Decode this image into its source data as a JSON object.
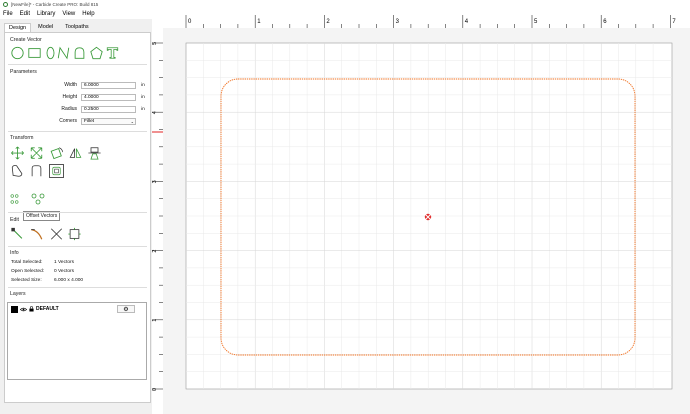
{
  "window": {
    "title": "[NewFile]* - Carbide Create PRO: Build 815"
  },
  "menu": {
    "items": [
      "File",
      "Edit",
      "Library",
      "View",
      "Help"
    ]
  },
  "tabs": [
    "Design",
    "Model",
    "Toolpaths"
  ],
  "panel": {
    "create_vector_title": "Create Vector",
    "parameters_title": "Parameters",
    "transform_title": "Transform",
    "edit_title": "Edit",
    "info_title": "Info",
    "layers_title": "Layers",
    "tooltip": "Offset Vectors"
  },
  "parameters": {
    "width": {
      "label": "Width",
      "value": "6.0000",
      "unit": "in"
    },
    "height": {
      "label": "Height",
      "value": "4.0000",
      "unit": "in"
    },
    "radius": {
      "label": "Radius",
      "value": "0.2500",
      "unit": "in"
    },
    "corners": {
      "label": "Corners",
      "value": "Fillet"
    }
  },
  "info": {
    "total_selected_label": "Total Selected:",
    "total_selected_value": "1 Vectors",
    "open_selected_label": "Open Selected:",
    "open_selected_value": "0 Vectors",
    "selected_size_label": "Selected Size:",
    "selected_size_value": "6.000 x 4.000"
  },
  "layers": [
    {
      "name": "DEFAULT",
      "color": "#000000"
    }
  ],
  "canvas": {
    "ruler_x": [
      "0",
      "1",
      "2",
      "3",
      "4",
      "5",
      "6",
      "7"
    ],
    "ruler_y": [
      "5",
      "4",
      "3",
      "2",
      "1",
      "0"
    ],
    "shape_color": "#f07020",
    "accent_color": "#2e8b2e"
  }
}
